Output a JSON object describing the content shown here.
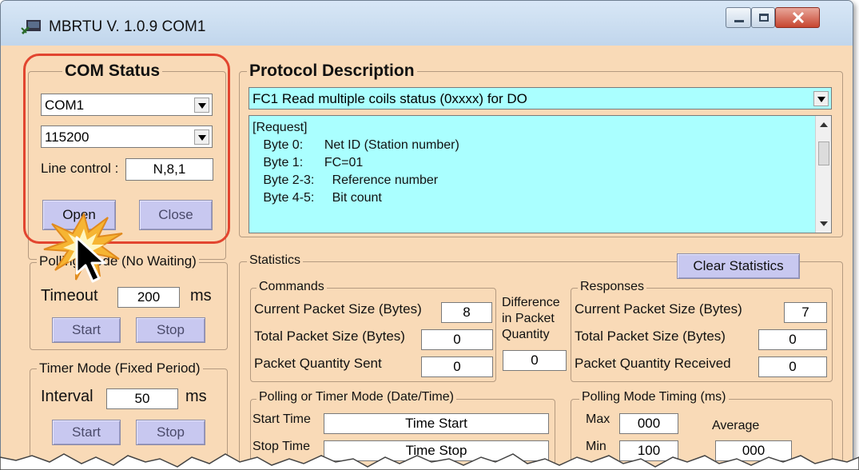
{
  "window": {
    "title": "MBRTU  V. 1.0.9  COM1",
    "controls": [
      "minimize",
      "maximize",
      "close"
    ]
  },
  "com_status": {
    "title": "COM Status",
    "port": "COM1",
    "baud": "115200",
    "line_control_label": "Line control :",
    "line_control_value": "N,8,1",
    "open_label": "Open",
    "close_label": "Close"
  },
  "polling_mode": {
    "title": "Polling Mode (No Waiting)",
    "timeout_label": "Timeout",
    "timeout_value": "200",
    "unit": "ms",
    "start_label": "Start",
    "stop_label": "Stop"
  },
  "timer_mode": {
    "title": "Timer Mode (Fixed Period)",
    "interval_label": "Interval",
    "interval_value": "50",
    "unit": "ms",
    "start_label": "Start",
    "stop_label": "Stop"
  },
  "protocol": {
    "title": "Protocol Description",
    "selected": "FC1  Read multiple coils status (0xxxx)  for DO",
    "description_lines": [
      "[Request]",
      "   Byte 0:      Net ID (Station number)",
      "   Byte 1:      FC=01",
      "   Byte 2-3:     Reference number",
      "   Byte 4-5:     Bit count"
    ]
  },
  "statistics": {
    "title": "Statistics",
    "clear_label": "Clear Statistics",
    "commands": {
      "title": "Commands",
      "current_label": "Current Packet Size (Bytes)",
      "current_value": "8",
      "total_label": "Total Packet Size (Bytes)",
      "total_value": "0",
      "quantity_label": "Packet Quantity Sent",
      "quantity_value": "0"
    },
    "difference": {
      "line1": "Difference",
      "line2": "in Packet",
      "line3": "Quantity",
      "value": "0"
    },
    "responses": {
      "title": "Responses",
      "current_label": "Current Packet Size (Bytes)",
      "current_value": "7",
      "total_label": "Total Packet Size (Bytes)",
      "total_value": "0",
      "quantity_label": "Packet Quantity Received",
      "quantity_value": "0"
    },
    "polling_time": {
      "title": "Polling  or Timer Mode  (Date/Time)",
      "start_label": "Start Time",
      "start_value": "Time Start",
      "stop_label": "Stop Time",
      "stop_value": "Time Stop"
    },
    "polling_timing": {
      "title": "Polling Mode Timing (ms)",
      "max_label": "Max",
      "max_value": "000",
      "min_label": "Min",
      "min_value": "100",
      "average_label": "Average",
      "average_value": "000"
    }
  },
  "colors": {
    "window_bg": "#f9dab7",
    "memo_bg": "#aaffff",
    "button_bg": "#c8c8f0",
    "highlight": "#e2452f",
    "starburst": "#f6b533"
  }
}
